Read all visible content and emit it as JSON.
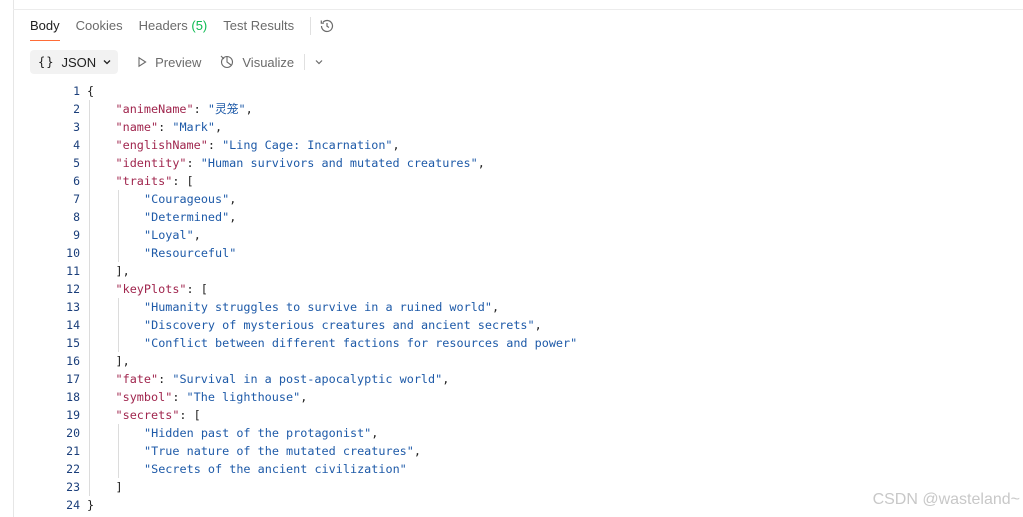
{
  "tabs": [
    {
      "label": "Body"
    },
    {
      "label": "Cookies"
    },
    {
      "label": "Headers",
      "count": "(5)"
    },
    {
      "label": "Test Results"
    }
  ],
  "toolbar": {
    "format_label": "JSON",
    "preview_label": "Preview",
    "visualize_label": "Visualize"
  },
  "code_lines": [
    {
      "n": "1",
      "indent": 0,
      "parts": [
        [
          "p",
          "{"
        ]
      ]
    },
    {
      "n": "2",
      "indent": 1,
      "parts": [
        [
          "k",
          "\"animeName\""
        ],
        [
          "p",
          ": "
        ],
        [
          "s",
          "\"灵笼\""
        ],
        [
          "p",
          ","
        ]
      ]
    },
    {
      "n": "3",
      "indent": 1,
      "parts": [
        [
          "k",
          "\"name\""
        ],
        [
          "p",
          ": "
        ],
        [
          "s",
          "\"Mark\""
        ],
        [
          "p",
          ","
        ]
      ]
    },
    {
      "n": "4",
      "indent": 1,
      "parts": [
        [
          "k",
          "\"englishName\""
        ],
        [
          "p",
          ": "
        ],
        [
          "s",
          "\"Ling Cage: Incarnation\""
        ],
        [
          "p",
          ","
        ]
      ]
    },
    {
      "n": "5",
      "indent": 1,
      "parts": [
        [
          "k",
          "\"identity\""
        ],
        [
          "p",
          ": "
        ],
        [
          "s",
          "\"Human survivors and mutated creatures\""
        ],
        [
          "p",
          ","
        ]
      ]
    },
    {
      "n": "6",
      "indent": 1,
      "parts": [
        [
          "k",
          "\"traits\""
        ],
        [
          "p",
          ": ["
        ]
      ]
    },
    {
      "n": "7",
      "indent": 2,
      "parts": [
        [
          "s",
          "\"Courageous\""
        ],
        [
          "p",
          ","
        ]
      ]
    },
    {
      "n": "8",
      "indent": 2,
      "parts": [
        [
          "s",
          "\"Determined\""
        ],
        [
          "p",
          ","
        ]
      ]
    },
    {
      "n": "9",
      "indent": 2,
      "parts": [
        [
          "s",
          "\"Loyal\""
        ],
        [
          "p",
          ","
        ]
      ]
    },
    {
      "n": "10",
      "indent": 2,
      "parts": [
        [
          "s",
          "\"Resourceful\""
        ]
      ]
    },
    {
      "n": "11",
      "indent": 1,
      "parts": [
        [
          "p",
          "],"
        ]
      ]
    },
    {
      "n": "12",
      "indent": 1,
      "parts": [
        [
          "k",
          "\"keyPlots\""
        ],
        [
          "p",
          ": ["
        ]
      ]
    },
    {
      "n": "13",
      "indent": 2,
      "parts": [
        [
          "s",
          "\"Humanity struggles to survive in a ruined world\""
        ],
        [
          "p",
          ","
        ]
      ]
    },
    {
      "n": "14",
      "indent": 2,
      "parts": [
        [
          "s",
          "\"Discovery of mysterious creatures and ancient secrets\""
        ],
        [
          "p",
          ","
        ]
      ]
    },
    {
      "n": "15",
      "indent": 2,
      "parts": [
        [
          "s",
          "\"Conflict between different factions for resources and power\""
        ]
      ]
    },
    {
      "n": "16",
      "indent": 1,
      "parts": [
        [
          "p",
          "],"
        ]
      ]
    },
    {
      "n": "17",
      "indent": 1,
      "parts": [
        [
          "k",
          "\"fate\""
        ],
        [
          "p",
          ": "
        ],
        [
          "s",
          "\"Survival in a post-apocalyptic world\""
        ],
        [
          "p",
          ","
        ]
      ]
    },
    {
      "n": "18",
      "indent": 1,
      "parts": [
        [
          "k",
          "\"symbol\""
        ],
        [
          "p",
          ": "
        ],
        [
          "s",
          "\"The lighthouse\""
        ],
        [
          "p",
          ","
        ]
      ]
    },
    {
      "n": "19",
      "indent": 1,
      "parts": [
        [
          "k",
          "\"secrets\""
        ],
        [
          "p",
          ": ["
        ]
      ]
    },
    {
      "n": "20",
      "indent": 2,
      "parts": [
        [
          "s",
          "\"Hidden past of the protagonist\""
        ],
        [
          "p",
          ","
        ]
      ]
    },
    {
      "n": "21",
      "indent": 2,
      "parts": [
        [
          "s",
          "\"True nature of the mutated creatures\""
        ],
        [
          "p",
          ","
        ]
      ]
    },
    {
      "n": "22",
      "indent": 2,
      "parts": [
        [
          "s",
          "\"Secrets of the ancient civilization\""
        ]
      ]
    },
    {
      "n": "23",
      "indent": 1,
      "parts": [
        [
          "p",
          "]"
        ]
      ]
    },
    {
      "n": "24",
      "indent": 0,
      "parts": [
        [
          "p",
          "}"
        ]
      ]
    }
  ],
  "watermark": "CSDN @wasteland~",
  "colors": {
    "accent": "#ff6c37",
    "count_green": "#0cbb52",
    "json_key": "#a0264e",
    "json_string": "#1e5aa8"
  },
  "icons": [
    "history-icon",
    "chevron-down-icon",
    "play-icon",
    "visualize-icon"
  ]
}
